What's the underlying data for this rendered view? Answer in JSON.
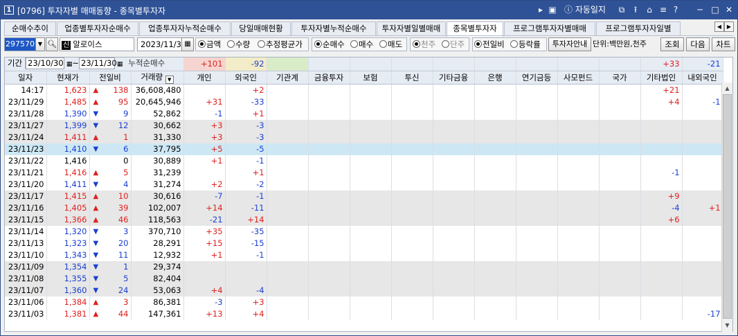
{
  "window": {
    "number": "1",
    "title": "[0796] 투자자별 매매동향 - 종목별투자자",
    "controls": [
      "▸",
      "▣",
      "ⓘ 자동일지",
      "⧉",
      "⭱",
      "⌂",
      "≡",
      "?",
      "─",
      "□",
      "✕"
    ]
  },
  "tabs": [
    "순매수추이",
    "업종별투자자순매수",
    "업종투자자누적순매수",
    "당일매매현황",
    "투자자별누적순매수",
    "투자자별일별매매",
    "종목별투자자",
    "프로그램투자자별매매",
    "프로그램투자자일별"
  ],
  "active_tab": "종목별투자자",
  "toolbar": {
    "code": "297570",
    "market_badge": "신",
    "stock_name": "알로이스",
    "date": "2023/11/30",
    "radio_group1": [
      {
        "label": "금액",
        "selected": true
      },
      {
        "label": "수량",
        "selected": false
      },
      {
        "label": "추정평균가",
        "selected": false
      }
    ],
    "radio_group2": [
      {
        "label": "순매수",
        "selected": true
      },
      {
        "label": "매수",
        "selected": false
      },
      {
        "label": "매도",
        "selected": false
      }
    ],
    "radio_group3": [
      {
        "label": "천주",
        "selected": true
      },
      {
        "label": "단주",
        "selected": false
      }
    ],
    "radio_group4": [
      {
        "label": "전일비",
        "selected": true
      },
      {
        "label": "등락률",
        "selected": false
      }
    ],
    "guide_button": "투자자안내",
    "unit_text": "단위:백만원,천주",
    "query_button": "조회",
    "next_button": "다음",
    "chart_button": "차트"
  },
  "period": {
    "label": "기간",
    "start": "23/10/30",
    "separator": "~",
    "end": "23/11/30",
    "cumulative_label": "누적순매수",
    "sums": {
      "개인": "+101",
      "외국인": "-92",
      "기관계": "",
      "금융투자": "",
      "보험": "",
      "투신": "",
      "기타금융": "",
      "은행": "",
      "연기금등": "",
      "사모펀드": "",
      "국가": "",
      "기타법인": "+33",
      "내외국인": "-21"
    }
  },
  "columns": [
    "일자",
    "현재가",
    "전일비",
    "거래량",
    "개인",
    "외국인",
    "기관계",
    "금융투자",
    "보험",
    "투신",
    "기타금융",
    "은행",
    "연기금등",
    "사모펀드",
    "국가",
    "기타법인",
    "내외국인"
  ],
  "rows": [
    {
      "date": "14:17",
      "price": "1,623",
      "dir": "up",
      "change": "138",
      "volume": "36,608,480",
      "indiv": "",
      "foreign": "+2",
      "etc_corp": "+21",
      "in_foreign": "",
      "shade": false
    },
    {
      "date": "23/11/29",
      "price": "1,485",
      "dir": "up",
      "change": "95",
      "volume": "20,645,946",
      "indiv": "+31",
      "foreign": "-33",
      "etc_corp": "+4",
      "in_foreign": "-1",
      "shade": false
    },
    {
      "date": "23/11/28",
      "price": "1,390",
      "dir": "dn",
      "change": "9",
      "volume": "52,862",
      "indiv": "-1",
      "foreign": "+1",
      "etc_corp": "",
      "in_foreign": "",
      "shade": false
    },
    {
      "date": "23/11/27",
      "price": "1,399",
      "dir": "dn",
      "change": "12",
      "volume": "30,662",
      "indiv": "+3",
      "foreign": "-3",
      "etc_corp": "",
      "in_foreign": "",
      "shade": true
    },
    {
      "date": "23/11/24",
      "price": "1,411",
      "dir": "up",
      "change": "1",
      "volume": "31,330",
      "indiv": "+3",
      "foreign": "-3",
      "etc_corp": "",
      "in_foreign": "",
      "shade": true
    },
    {
      "date": "23/11/23",
      "price": "1,410",
      "dir": "dn",
      "change": "6",
      "volume": "37,795",
      "indiv": "+5",
      "foreign": "-5",
      "etc_corp": "",
      "in_foreign": "",
      "shade": false,
      "selected": true
    },
    {
      "date": "23/11/22",
      "price": "1,416",
      "dir": "flat",
      "change": "0",
      "volume": "30,889",
      "indiv": "+1",
      "foreign": "-1",
      "etc_corp": "",
      "in_foreign": "",
      "shade": false
    },
    {
      "date": "23/11/21",
      "price": "1,416",
      "dir": "up",
      "change": "5",
      "volume": "31,239",
      "indiv": "",
      "foreign": "+1",
      "etc_corp": "-1",
      "in_foreign": "",
      "shade": false
    },
    {
      "date": "23/11/20",
      "price": "1,411",
      "dir": "dn",
      "change": "4",
      "volume": "31,274",
      "indiv": "+2",
      "foreign": "-2",
      "etc_corp": "",
      "in_foreign": "",
      "shade": false
    },
    {
      "date": "23/11/17",
      "price": "1,415",
      "dir": "up",
      "change": "10",
      "volume": "30,616",
      "indiv": "-7",
      "foreign": "-1",
      "etc_corp": "+9",
      "in_foreign": "",
      "shade": true
    },
    {
      "date": "23/11/16",
      "price": "1,405",
      "dir": "up",
      "change": "39",
      "volume": "102,007",
      "indiv": "+14",
      "foreign": "-11",
      "etc_corp": "-4",
      "in_foreign": "+1",
      "shade": true
    },
    {
      "date": "23/11/15",
      "price": "1,366",
      "dir": "up",
      "change": "46",
      "volume": "118,563",
      "indiv": "-21",
      "foreign": "+14",
      "etc_corp": "+6",
      "in_foreign": "",
      "shade": true
    },
    {
      "date": "23/11/14",
      "price": "1,320",
      "dir": "dn",
      "change": "3",
      "volume": "370,710",
      "indiv": "+35",
      "foreign": "-35",
      "etc_corp": "",
      "in_foreign": "",
      "shade": false
    },
    {
      "date": "23/11/13",
      "price": "1,323",
      "dir": "dn",
      "change": "20",
      "volume": "28,291",
      "indiv": "+15",
      "foreign": "-15",
      "etc_corp": "",
      "in_foreign": "",
      "shade": false
    },
    {
      "date": "23/11/10",
      "price": "1,343",
      "dir": "dn",
      "change": "11",
      "volume": "12,932",
      "indiv": "+1",
      "foreign": "-1",
      "etc_corp": "",
      "in_foreign": "",
      "shade": false
    },
    {
      "date": "23/11/09",
      "price": "1,354",
      "dir": "dn",
      "change": "1",
      "volume": "29,374",
      "indiv": "",
      "foreign": "",
      "etc_corp": "",
      "in_foreign": "",
      "shade": true
    },
    {
      "date": "23/11/08",
      "price": "1,355",
      "dir": "dn",
      "change": "5",
      "volume": "82,404",
      "indiv": "",
      "foreign": "",
      "etc_corp": "",
      "in_foreign": "",
      "shade": true
    },
    {
      "date": "23/11/07",
      "price": "1,360",
      "dir": "dn",
      "change": "24",
      "volume": "53,063",
      "indiv": "+4",
      "foreign": "-4",
      "etc_corp": "",
      "in_foreign": "",
      "shade": true
    },
    {
      "date": "23/11/06",
      "price": "1,384",
      "dir": "up",
      "change": "3",
      "volume": "86,381",
      "indiv": "-3",
      "foreign": "+3",
      "etc_corp": "",
      "in_foreign": "",
      "shade": false
    },
    {
      "date": "23/11/03",
      "price": "1,381",
      "dir": "up",
      "change": "44",
      "volume": "147,361",
      "indiv": "+13",
      "foreign": "+4",
      "etc_corp": "",
      "in_foreign": "-17",
      "shade": false
    }
  ],
  "colors": {
    "up": "#e0201e",
    "down": "#1a3fd0",
    "titlebar": "#2f5296",
    "selected_row": "#cde8f4",
    "indiv_sum_bg": "#f6d4cf",
    "foreign_sum_bg": "#f3ecc8",
    "inst_sum_bg": "#d9ecc8"
  }
}
